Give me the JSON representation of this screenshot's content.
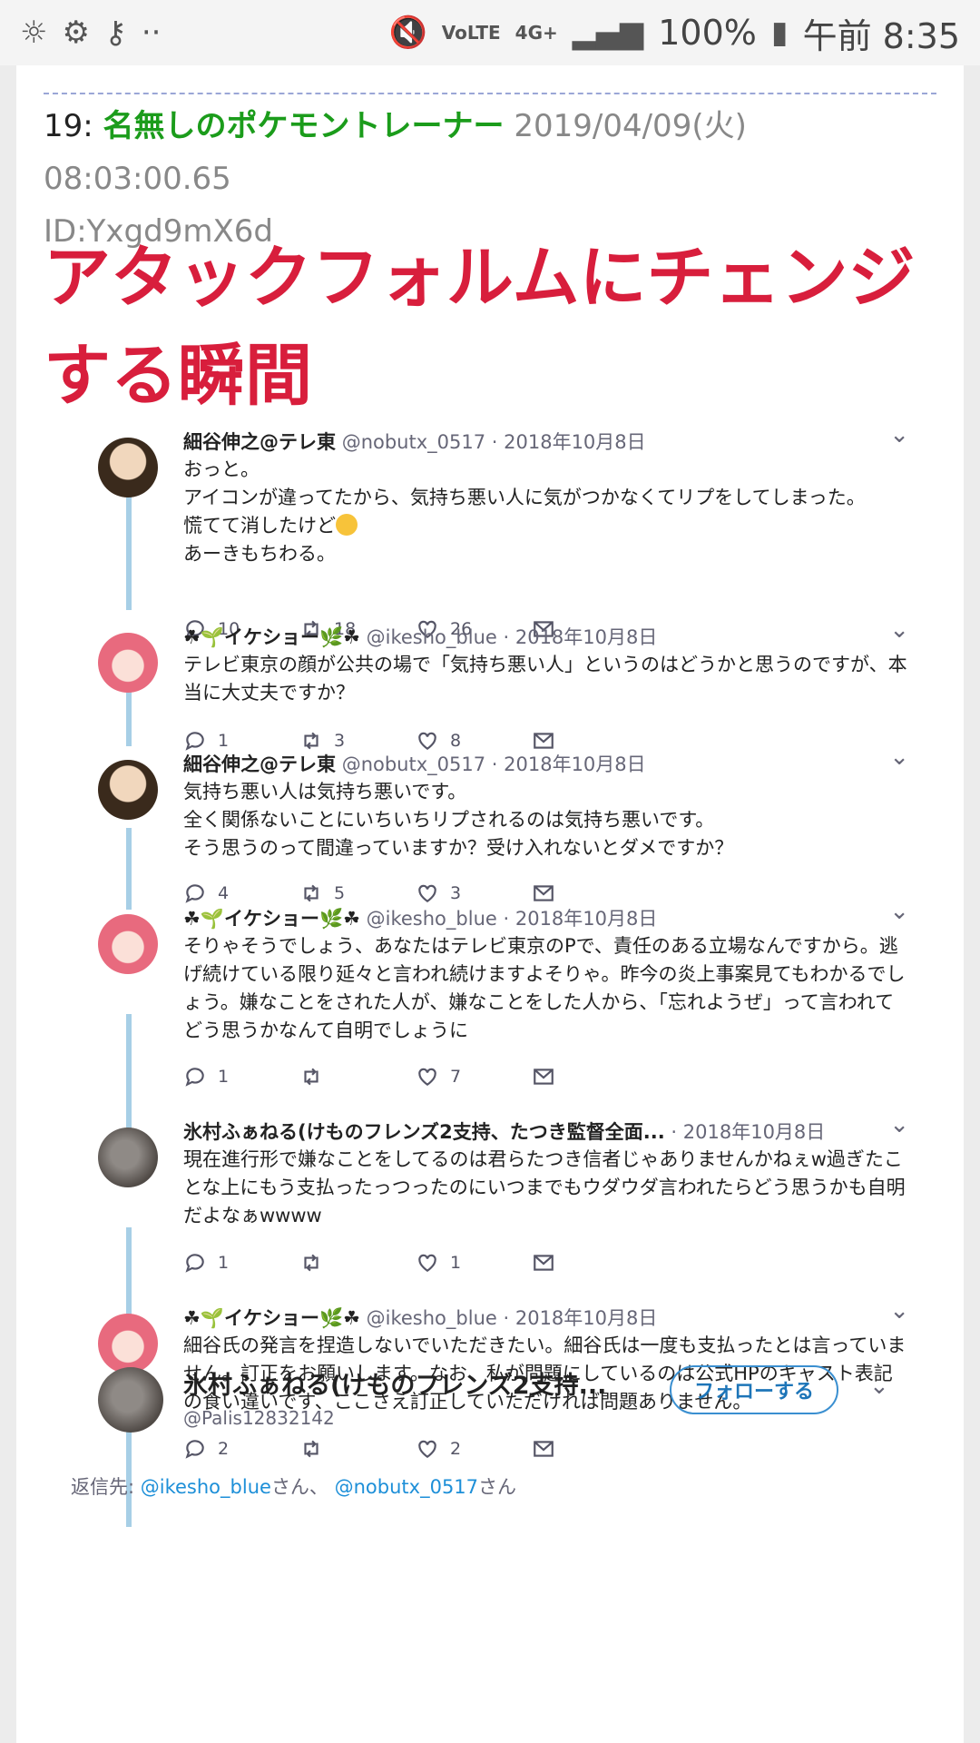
{
  "status_bar": {
    "battery": "100%",
    "time": "午前 8:35",
    "network": "4G+",
    "volte": "VoLTE",
    "more": "··"
  },
  "post": {
    "number": "19",
    "colon": ":",
    "name": "名無しのポケモントレーナー",
    "datetime": "2019/04/09(火) 08:03:00.65",
    "id": "ID:Yxgd9mX6d",
    "body": "アタックフォルムにチェンジする瞬間"
  },
  "tweets": [
    {
      "name": "細谷伸之@テレ東",
      "handle": "@nobutx_0517",
      "date": "· 2018年10月8日",
      "text_a": "おっと。\nアイコンが違ってたから、気持ち悪い人に気がつかなくてリプをしてしまった。\n慌てて消したけど",
      "text_b": "\nあーきもちわる。",
      "replies": "10",
      "retweets": "18",
      "likes": "26"
    },
    {
      "name": "☘🌱イケショー🌿☘",
      "handle": "@ikesho_blue",
      "date": "· 2018年10月8日",
      "text": "テレビ東京の顔が公共の場で「気持ち悪い人」というのはどうかと思うのですが、本当に大丈夫ですか？",
      "replies": "1",
      "retweets": "3",
      "likes": "8"
    },
    {
      "name": "細谷伸之@テレ東",
      "handle": "@nobutx_0517",
      "date": "· 2018年10月8日",
      "text": "気持ち悪い人は気持ち悪いです。\n全く関係ないことにいちいちリプされるのは気持ち悪いです。\nそう思うのって間違っていますか？受け入れないとダメですか？",
      "replies": "4",
      "retweets": "5",
      "likes": "3"
    },
    {
      "name": "☘🌱イケショー🌿☘",
      "handle": "@ikesho_blue",
      "date": "· 2018年10月8日",
      "text": "そりゃそうでしょう、あなたはテレビ東京のPで、責任のある立場なんですから。逃げ続けている限り延々と言われ続けますよそりゃ。昨今の炎上事案見てもわかるでしょう。嫌なことをされた人が、嫌なことをした人から、「忘れようぜ」って言われてどう思うかなんて自明でしょうに",
      "replies": "1",
      "retweets": "",
      "likes": "7"
    },
    {
      "name": "氷村ふぁねる(けものフレンズ2支持、たつき監督全面...",
      "handle": "",
      "date": "· 2018年10月8日",
      "text": "現在進行形で嫌なことをしてるのは君らたつき信者じゃありませんかねぇw過ぎたことな上にもう支払ったっつったのにいつまでもウダウダ言われたらどう思うかも自明だよなぁwwww",
      "replies": "1",
      "retweets": "",
      "likes": "1"
    },
    {
      "name": "☘🌱イケショー🌿☘",
      "handle": "@ikesho_blue",
      "date": "· 2018年10月8日",
      "text": "細谷氏の発言を捏造しないでいただきたい。細谷氏は一度も支払ったとは言っていません。訂正をお願いします。なお、私が問題にしているのは公式HPのキャスト表記の食い違いです、ここさえ訂正していただければ問題ありません。",
      "replies": "2",
      "retweets": "",
      "likes": "2"
    }
  ],
  "last_tweet": {
    "name": "氷村ふぁねる(けものフレンズ2支持...",
    "handle": "@Palis12832142",
    "follow_label": "フォローする",
    "reply_to_label": "返信先:",
    "mention_1": "@ikesho_blue",
    "san_1": "さん、",
    "mention_2": "@nobutx_0517",
    "san_2": "さん"
  },
  "icons": [
    "reply-icon",
    "retweet-icon",
    "like-icon",
    "dm-icon",
    "caret-down-icon"
  ]
}
